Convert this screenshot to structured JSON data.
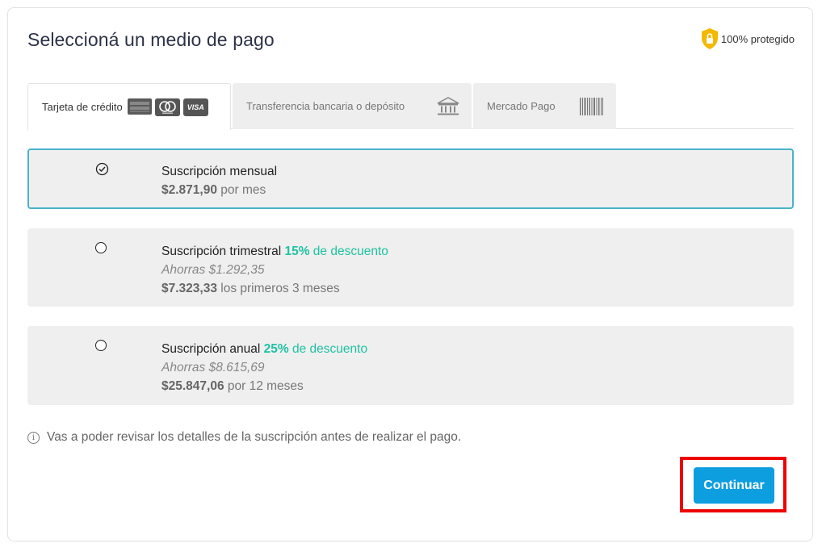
{
  "header": {
    "title": "Seleccioná un medio de pago",
    "protected_label": "100% protegido"
  },
  "tabs": [
    {
      "label": "Tarjeta de crédito",
      "icons": [
        "amex-icon",
        "mastercard-icon",
        "visa-icon"
      ],
      "active": true
    },
    {
      "label": "Transferencia bancaria o depósito",
      "icon": "bank-icon",
      "active": false
    },
    {
      "label": "Mercado Pago",
      "icon": "barcode-icon",
      "active": false
    }
  ],
  "card_brands": {
    "visa": "VISA"
  },
  "options": [
    {
      "name": "Suscripción mensual",
      "price": "$2.871,90",
      "price_suffix": " por mes",
      "selected": true
    },
    {
      "name": "Suscripción trimestral",
      "discount_pct": "15%",
      "discount_text": " de descuento",
      "savings": "Ahorras $1.292,35",
      "price": "$7.323,33",
      "price_suffix": " los primeros 3 meses",
      "selected": false
    },
    {
      "name": "Suscripción anual",
      "discount_pct": "25%",
      "discount_text": " de descuento",
      "savings": "Ahorras $8.615,69",
      "price": "$25.847,06",
      "price_suffix": " por 12 meses",
      "selected": false
    }
  ],
  "info": {
    "icon": "info-icon",
    "text": "Vas a poder revisar los detalles de la suscripción antes de realizar el pago."
  },
  "actions": {
    "continue_label": "Continuar"
  },
  "colors": {
    "accent": "#0d9ee0",
    "selected_border": "#4ab3c9",
    "discount": "#1ec2a3",
    "highlight": "#ee0000",
    "shield": "#f5b800"
  }
}
